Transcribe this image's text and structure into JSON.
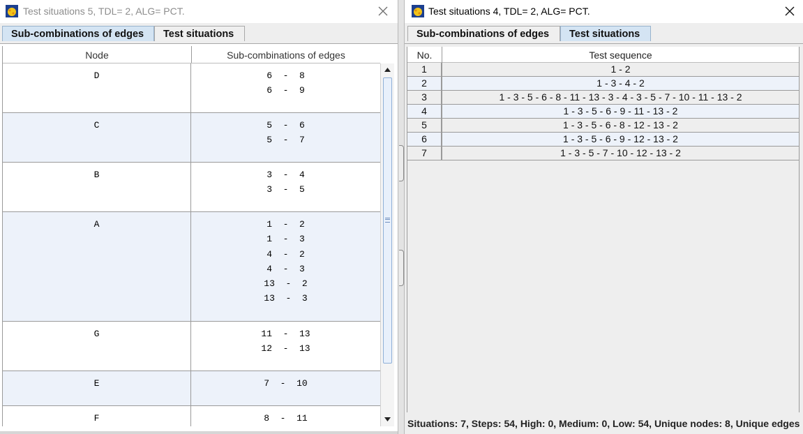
{
  "left_window": {
    "title": "Test situations 5, TDL= 2, ALG= PCT.",
    "tabs": [
      {
        "label": "Sub-combinations of edges",
        "active": true
      },
      {
        "label": "Test situations",
        "active": false
      }
    ],
    "table": {
      "headers": {
        "node": "Node",
        "edges": "Sub-combinations of edges"
      },
      "rows": [
        {
          "node": "D",
          "edges": [
            "6  -  8",
            "6  -  9"
          ]
        },
        {
          "node": "C",
          "edges": [
            "5  -  6",
            "5  -  7"
          ]
        },
        {
          "node": "B",
          "edges": [
            "3  -  4",
            "3  -  5"
          ]
        },
        {
          "node": "A",
          "edges": [
            "1  -  2",
            "1  -  3",
            "4  -  2",
            "4  -  3",
            "13  -  2",
            "13  -  3"
          ]
        },
        {
          "node": "G",
          "edges": [
            "11  -  13",
            "12  -  13"
          ]
        },
        {
          "node": "E",
          "edges": [
            "7  -  10"
          ]
        },
        {
          "node": "F",
          "edges": [
            "8  -  11"
          ]
        }
      ]
    }
  },
  "right_window": {
    "title": "Test situations 4, TDL= 2, ALG= PCT.",
    "tabs": [
      {
        "label": "Sub-combinations of edges",
        "active": false
      },
      {
        "label": "Test situations",
        "active": true
      }
    ],
    "table": {
      "headers": {
        "no": "No.",
        "sequence": "Test sequence"
      },
      "rows": [
        {
          "no": "1",
          "sequence": "1 - 2"
        },
        {
          "no": "2",
          "sequence": "1 - 3 - 4 - 2"
        },
        {
          "no": "3",
          "sequence": "1 - 3 - 5 - 6 - 8 - 11 - 13 - 3 - 4 - 3 - 5 - 7 - 10 - 11 - 13 - 2"
        },
        {
          "no": "4",
          "sequence": "1 - 3 - 5 - 6 - 9 - 11 - 13 - 2"
        },
        {
          "no": "5",
          "sequence": "1 - 3 - 5 - 6 - 8 - 12 - 13 - 2"
        },
        {
          "no": "6",
          "sequence": "1 - 3 - 5 - 6 - 9 - 12 - 13 - 2"
        },
        {
          "no": "7",
          "sequence": "1 - 3 - 5 - 7 - 10 - 12 - 13 - 2"
        }
      ]
    },
    "status": "Situations: 7, Steps: 54, High: 0, Medium: 0, Low: 54, Unique nodes: 8, Unique edges"
  },
  "icons": {
    "app": "app-logo-icon",
    "close": "close-icon",
    "scroll_up": "arrow-up-icon",
    "scroll_down": "arrow-down-icon"
  },
  "colors": {
    "active_tab": "#d4e4f3",
    "alt_row": "#edf2fa",
    "grid": "#9a9a9a"
  }
}
